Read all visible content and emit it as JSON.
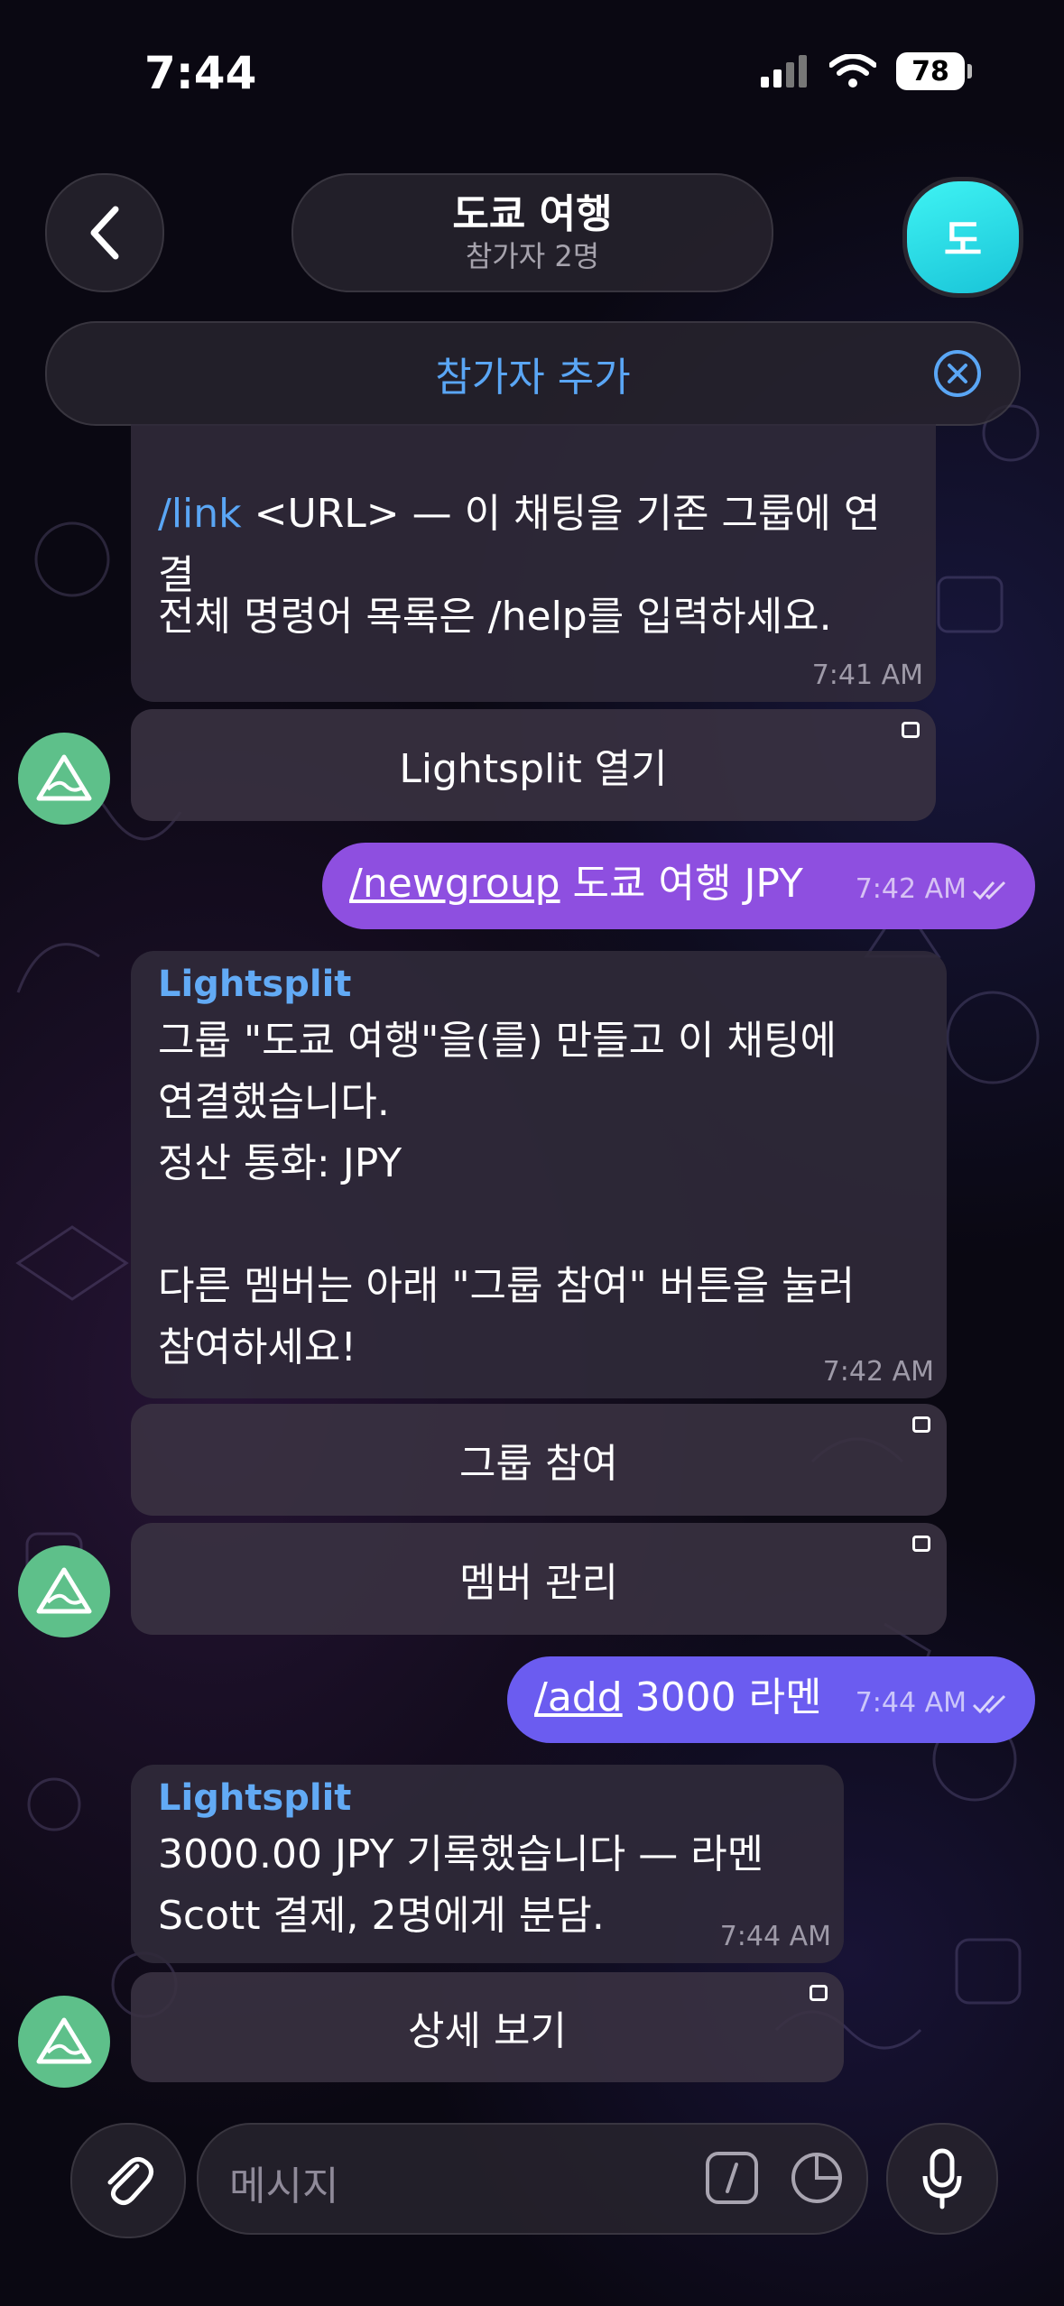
{
  "status_bar": {
    "time": "7:44",
    "battery": "78"
  },
  "header": {
    "title": "도쿄 여행",
    "subtitle": "참가자 2명",
    "avatar_letter": "도"
  },
  "add_participant": {
    "label": "참가자 추가"
  },
  "messages": {
    "m1": {
      "partial_command": "/link",
      "partial_text": " <URL> — 이 채팅을 기존 그룹에 연\n결",
      "text2": "전체 명령어 목록은 /help를 입력하세요.",
      "time": "7:41 AM",
      "button": "Lightsplit 열기"
    },
    "m2": {
      "command": "/newgroup",
      "text": " 도쿄 여행 JPY",
      "time": "7:42 AM"
    },
    "m3": {
      "sender": "Lightsplit",
      "text": "그룹 \"도쿄 여행\"을(를) 만들고 이 채팅에\n연결했습니다.\n정산 통화: JPY\n\n다른 멤버는 아래 \"그룹 참여\" 버튼을 눌러\n참여하세요!",
      "time": "7:42 AM",
      "button1": "그룹 참여",
      "button2": "멤버 관리"
    },
    "m4": {
      "command": "/add",
      "text": " 3000 라멘",
      "time": "7:44 AM"
    },
    "m5": {
      "sender": "Lightsplit",
      "text": "3000.00 JPY 기록했습니다 — 라멘\nScott 결제, 2명에게 분담.",
      "time": "7:44 AM",
      "button": "상세 보기"
    }
  },
  "input": {
    "placeholder": "메시지"
  },
  "colors": {
    "accent_blue": "#5aa6f5",
    "outgoing_bubble": "#8e4fe0",
    "bot_avatar": "#5ec08a",
    "group_avatar": "#2fe0e8"
  }
}
